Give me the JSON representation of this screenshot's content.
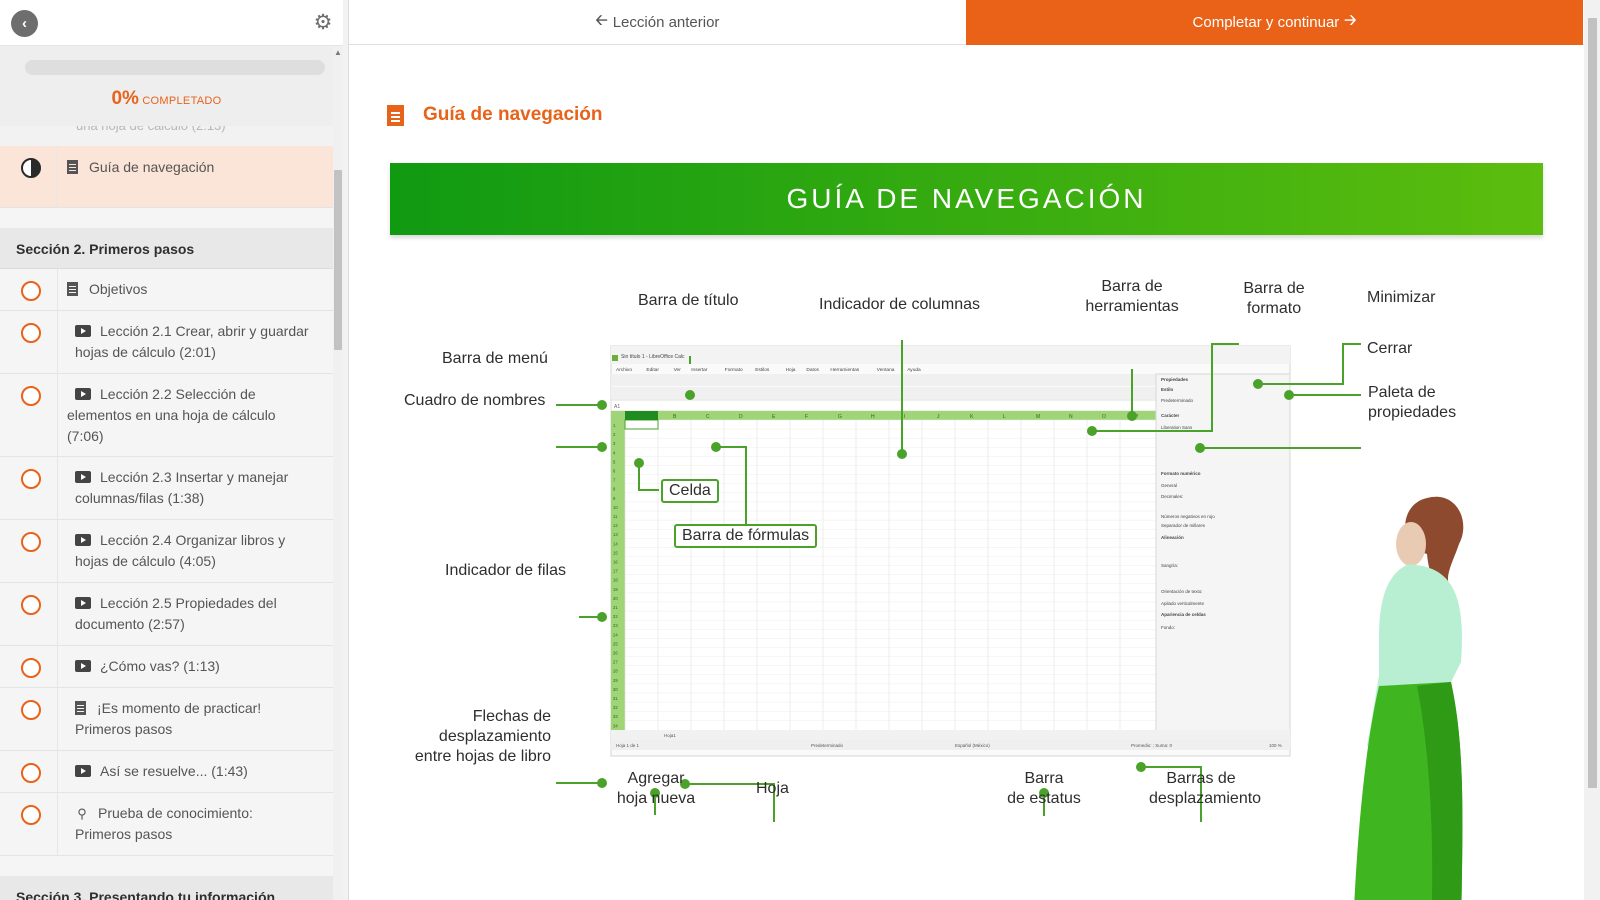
{
  "sidebar": {
    "back_icon": "chevron-left-icon",
    "settings_icon": "gear-icon",
    "progress": {
      "percent_value": 0,
      "percent_label": "0%",
      "label": "completado"
    },
    "partial_item_text": "Lección 1.2 Elementos que conforman una hoja de cálculo (2:13)",
    "items": [
      {
        "icon": "document-icon",
        "label": "Guía de navegación",
        "status": "in-progress",
        "active": true
      }
    ],
    "sections": [
      {
        "title": "Sección 2. Primeros pasos",
        "items": [
          {
            "icon": "document-icon",
            "label": "Objetivos"
          },
          {
            "icon": "video-icon",
            "label": "Lección 2.1 Crear, abrir y guardar hojas de cálculo (2:01)"
          },
          {
            "icon": "video-icon",
            "label": "Lección 2.2 Selección de elementos en una hoja de cálculo (7:06)"
          },
          {
            "icon": "video-icon",
            "label": "Lección 2.3 Insertar y manejar columnas/filas (1:38)"
          },
          {
            "icon": "video-icon",
            "label": "Lección 2.4 Organizar libros y hojas de cálculo (4:05)"
          },
          {
            "icon": "video-icon",
            "label": "Lección 2.5 Propiedades del documento (2:57)"
          },
          {
            "icon": "video-icon",
            "label": "¿Cómo vas? (1:13)"
          },
          {
            "icon": "document-icon",
            "label": "¡Es momento de practicar! Primeros pasos"
          },
          {
            "icon": "video-icon",
            "label": "Así se resuelve... (1:43)"
          },
          {
            "icon": "lightbulb-icon",
            "label": "Prueba de conocimiento: Primeros pasos"
          }
        ]
      },
      {
        "title": "Sección 3. Presentando tu información",
        "items": []
      }
    ]
  },
  "topbar": {
    "prev_label": "Lección anterior",
    "prev_icon": "arrow-left-icon",
    "next_label": "Completar y continuar",
    "next_icon": "arrow-right-icon"
  },
  "main": {
    "title_icon": "document-icon",
    "title": "Guía de navegación",
    "banner": "GUÍA DE NAVEGACIÓN",
    "diagram": {
      "callouts": {
        "barra_titulo": "Barra de título",
        "indicador_columnas": "Indicador de columnas",
        "barra_herramientas_1": "Barra de",
        "barra_herramientas_2": "herramientas",
        "barra_formato_1": "Barra de",
        "barra_formato_2": "formato",
        "minimizar": "Minimizar",
        "cerrar": "Cerrar",
        "barra_menu": "Barra de menú",
        "cuadro_nombres": "Cuadro de nombres",
        "paleta_1": "Paleta de",
        "paleta_2": "propiedades",
        "celda": "Celda",
        "barra_formulas": "Barra de fórmulas",
        "indicador_filas": "Indicador de filas",
        "flechas_1": "Flechas de",
        "flechas_2": "desplazamiento",
        "flechas_3": "entre hojas de libro",
        "agregar_1": "Agregar",
        "agregar_2": "hoja nueva",
        "hoja": "Hoja",
        "estatus_1": "Barra",
        "estatus_2": "de estatus",
        "barras_desp_1": "Barras de",
        "barras_desp_2": "desplazamiento"
      },
      "app": {
        "window_title": "Sin título 1 - LibreOffice Calc",
        "menu": [
          "Archivo",
          "Editar",
          "Ver",
          "Insertar",
          "Formato",
          "Estilos",
          "Hoja",
          "Datos",
          "Herramientas",
          "Ventana",
          "Ayuda"
        ],
        "name_box": "A1",
        "font_name": "Liberation Sans",
        "font_size": "10",
        "columns": [
          "A",
          "B",
          "C",
          "D",
          "E",
          "F",
          "G",
          "H",
          "I",
          "J",
          "K",
          "L",
          "M",
          "N",
          "O",
          "P"
        ],
        "sheet_tab": "Hoja1",
        "status_left": "Hoja 1 de 1",
        "status_style": "Predeterminado",
        "status_lang": "Español (México)",
        "status_sum": "Promedio: ; Suma: 0",
        "status_zoom": "100 %",
        "sidebar_panel": {
          "title": "Propiedades",
          "estilo": "Estilo",
          "estilo_value": "Predeterminado",
          "caracter": "Carácter",
          "font": "Liberation Sans",
          "size": "10",
          "formato_numerico": "Formato numérico",
          "general": "General",
          "decimales": "Decimales:",
          "ceros": "Ceros a la izquierda:",
          "neg_rojo": "Números negativos en rojo",
          "separador": "Separador de millares",
          "alineacion": "Alineación",
          "sangria": "Sangría:",
          "ajustar": "Ajustar el texto",
          "combinar": "Combinar celdas",
          "orientacion": "Orientación de texto:",
          "apilado": "Apilado verticalmente",
          "apariencia": "Apariencia de celdas",
          "fondo": "Fondo:"
        }
      }
    }
  },
  "colors": {
    "accent": "#e8631a",
    "banner_start": "#109a12",
    "banner_end": "#5cbd0e",
    "callout_line": "#4aa22b"
  }
}
